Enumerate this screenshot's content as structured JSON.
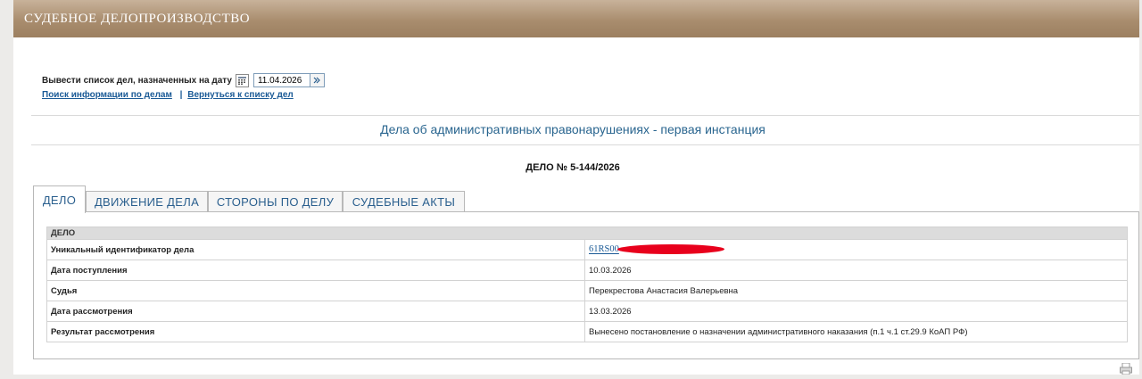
{
  "header": {
    "title": "СУДЕБНОЕ ДЕЛОПРОИЗВОДСТВО"
  },
  "date_filter": {
    "label": "Вывести список дел, назначенных на дату",
    "date_value": "11.04.2026"
  },
  "links": {
    "search": "Поиск информации по делам",
    "separator": "|",
    "back": "Вернуться к списку дел"
  },
  "category_title": "Дела об административных правонарушениях - первая инстанция",
  "case_number": "ДЕЛО № 5-144/2026",
  "tabs": [
    {
      "label": "ДЕЛО",
      "active": true
    },
    {
      "label": "ДВИЖЕНИЕ ДЕЛА",
      "active": false
    },
    {
      "label": "СТОРОНЫ ПО ДЕЛУ",
      "active": false
    },
    {
      "label": "СУДЕБНЫЕ АКТЫ",
      "active": false
    }
  ],
  "case_table": {
    "section_header": "ДЕЛО",
    "rows": [
      {
        "label": "Уникальный идентификатор дела",
        "value": "61RS00"
      },
      {
        "label": "Дата поступления",
        "value": "10.03.2026"
      },
      {
        "label": "Судья",
        "value": "Перекрестова Анастасия Валерьевна"
      },
      {
        "label": "Дата рассмотрения",
        "value": "13.03.2026"
      },
      {
        "label": "Результат рассмотрения",
        "value": "Вынесено постановление о назначении административного наказания (п.1 ч.1 ст.29.9 КоАП РФ)"
      }
    ]
  },
  "colors": {
    "header_brown": "#a98d6e",
    "link_blue": "#1a5a96",
    "redaction": "#e8001c"
  }
}
